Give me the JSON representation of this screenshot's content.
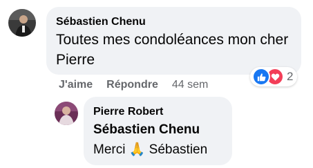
{
  "comment": {
    "author": "Sébastien Chenu",
    "text": "Toutes mes condoléances mon cher Pierre",
    "reactions": {
      "icons": [
        "like-icon",
        "love-icon"
      ],
      "count": "2",
      "colors": {
        "like": "#1877f2",
        "love": "#f33e58"
      }
    },
    "actions": {
      "like_label": "J'aime",
      "reply_label": "Répondre",
      "timestamp": "44 sem"
    }
  },
  "reply": {
    "author": "Pierre Robert",
    "mention": "Sébastien Chenu",
    "text_before": "Merci ",
    "emoji": "🙏",
    "text_after": " Sébastien"
  }
}
